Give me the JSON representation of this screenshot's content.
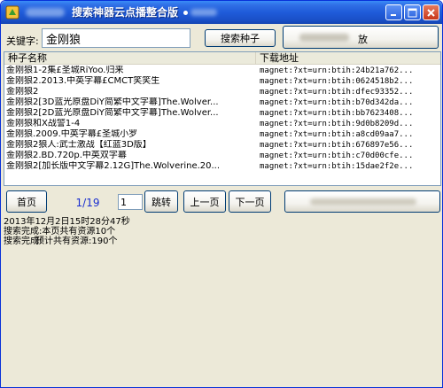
{
  "window": {
    "title": "搜索神器云点播整合版",
    "controls": {
      "minimize": "minimize",
      "maximize": "maximize",
      "close": "close"
    }
  },
  "search": {
    "label": "关键字:",
    "value": "金刚狼",
    "button": "搜索种子",
    "right_button_text": "放"
  },
  "list": {
    "columns": [
      "种子名称",
      "下载地址"
    ],
    "rows": [
      {
        "name": "金刚狼1-2集£圣城RiYoo.归来",
        "link": "magnet:?xt=urn:btih:24b21a762..."
      },
      {
        "name": "金刚狼2.2013.中英字幕£CMCT笑笑生",
        "link": "magnet:?xt=urn:btih:0624518b2..."
      },
      {
        "name": "金刚狼2",
        "link": "magnet:?xt=urn:btih:dfec93352..."
      },
      {
        "name": "金刚狼2[3D蓝光原盘DiY简繁中文字幕]The.Wolver...",
        "link": "magnet:?xt=urn:btih:b70d342da..."
      },
      {
        "name": "金刚狼2[2D蓝光原盘DiY简繁中文字幕]The.Wolver...",
        "link": "magnet:?xt=urn:btih:bb7623408..."
      },
      {
        "name": "金刚狼和X战警1-4",
        "link": "magnet:?xt=urn:btih:9d0b8209d..."
      },
      {
        "name": "金刚狼.2009.中英字幕£圣城小罗",
        "link": "magnet:?xt=urn:btih:a8cd09aa7..."
      },
      {
        "name": "金刚狼2狼人:武士激战【红蓝3D版】",
        "link": "magnet:?xt=urn:btih:676897e56..."
      },
      {
        "name": "金刚狼2.BD.720p.中英双字幕",
        "link": "magnet:?xt=urn:btih:c70d00cfe..."
      },
      {
        "name": "金刚狼2[加长版中文字幕2.12G]The.Wolverine.20...",
        "link": "magnet:?xt=urn:btih:15dae2f2e..."
      }
    ]
  },
  "pager": {
    "first": "首页",
    "indicator": "1/19",
    "page_input": "1",
    "jump": "跳转",
    "prev": "上一页",
    "next": "下一页"
  },
  "log": {
    "line1": "2013年12月2日15时28分47秒",
    "line2": "搜索完成:本页共有资源10个",
    "line3": "搜索完成:",
    "line4": "预计共有资源:190个"
  }
}
